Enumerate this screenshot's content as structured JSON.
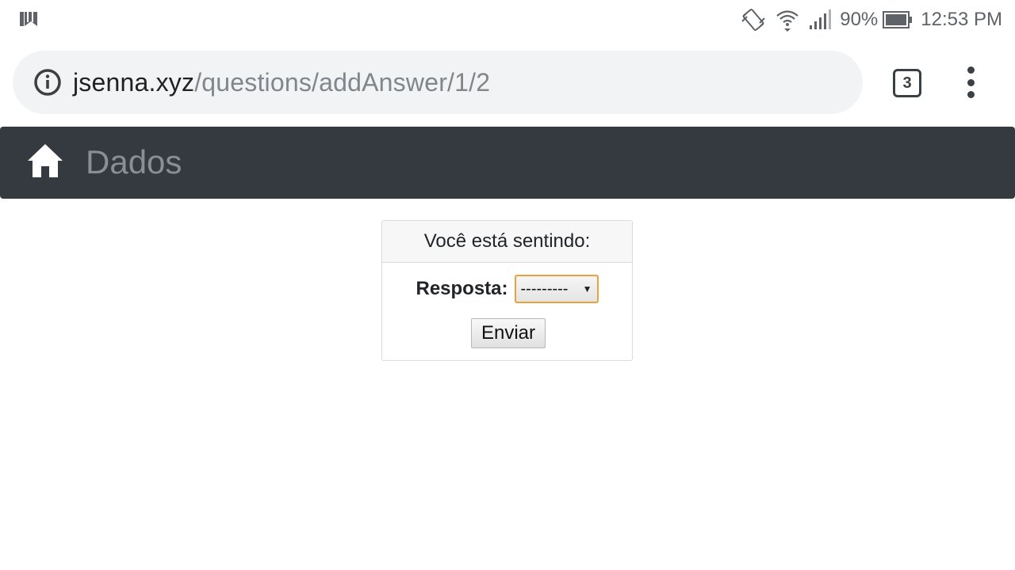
{
  "status_bar": {
    "battery": "90%",
    "time": "12:53 PM",
    "icons": [
      "notification-icon",
      "vibrate-icon",
      "wifi-icon",
      "signal-icon",
      "battery-icon"
    ]
  },
  "browser": {
    "url_domain": "jsenna.xyz",
    "url_path": "/questions/addAnswer/1/2",
    "tab_count": "3",
    "icons": [
      "info-icon",
      "overflow-menu-icon"
    ]
  },
  "navbar": {
    "brand": "Dados",
    "background": "#343a40",
    "icon": "home-icon"
  },
  "form": {
    "question": "Você está sentindo:",
    "answer_label": "Resposta:",
    "select_value": "---------",
    "submit_label": "Enviar"
  },
  "colors": {
    "select_focus_border": "#e8a33c",
    "url_bar_bg": "#f1f3f4"
  }
}
